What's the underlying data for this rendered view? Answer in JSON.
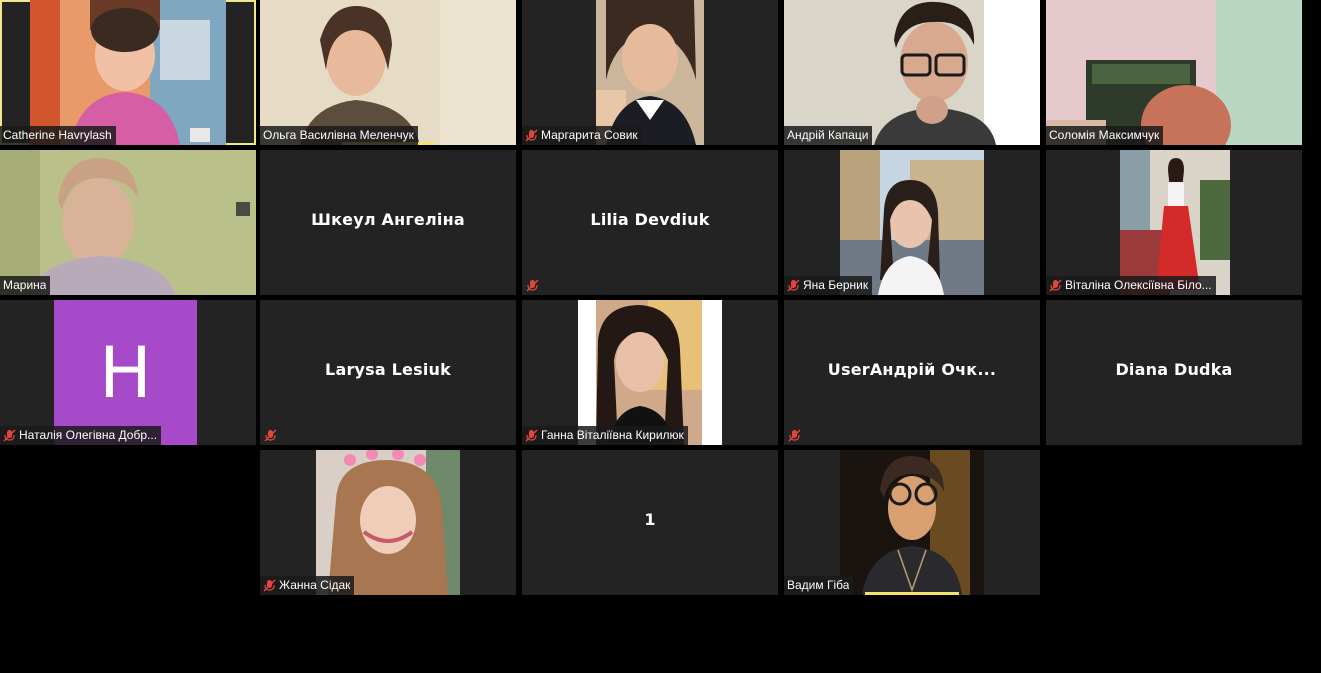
{
  "colors": {
    "background": "#000000",
    "tile": "#232323",
    "active_border": "#f0e68c",
    "mute_icon": "#e0463d",
    "avatar_h": "#a64ac9"
  },
  "participants": [
    {
      "name": "Catherine Havrylash",
      "muted": false,
      "video": true
    },
    {
      "name": "Ольга Василівна Меленчук",
      "muted": false,
      "video": true
    },
    {
      "name": "Маргарита Совик",
      "muted": true,
      "video": true
    },
    {
      "name": "Андрій Капаци",
      "muted": false,
      "video": true
    },
    {
      "name": "Соломія Максимчук",
      "muted": false,
      "video": true
    },
    {
      "name": "Марина",
      "muted": false,
      "video": true
    },
    {
      "name": "Шкеул Ангеліна",
      "muted": false,
      "video": false
    },
    {
      "name": "Lilia Devdiuk",
      "muted": true,
      "video": false
    },
    {
      "name": "Яна Берник",
      "muted": true,
      "video": true
    },
    {
      "name": "Віталіна Олексіївна Біло...",
      "muted": true,
      "video": true
    },
    {
      "name": "Наталія Олегівна Добр...",
      "muted": true,
      "video": false,
      "avatar_letter": "H"
    },
    {
      "name": "Larysa Lesiuk",
      "muted": true,
      "video": false
    },
    {
      "name": "Ганна Віталіївна Кирилюк",
      "muted": true,
      "video": true
    },
    {
      "name": "UserАндрій Очк...",
      "muted": true,
      "video": false
    },
    {
      "name": "Diana Dudka",
      "muted": false,
      "video": false
    },
    {
      "name": "Жанна Сідак",
      "muted": true,
      "video": true
    },
    {
      "name": "1",
      "muted": false,
      "video": false
    },
    {
      "name": "Вадим Гіба",
      "muted": false,
      "video": true
    }
  ]
}
